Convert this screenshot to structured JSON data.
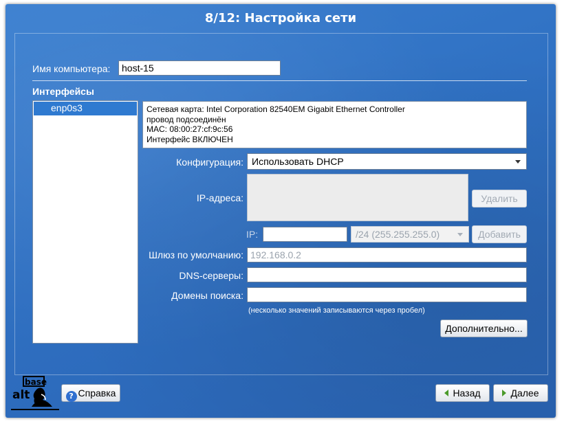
{
  "window": {
    "title": "8/12: Настройка сети"
  },
  "hostname": {
    "label": "Имя компьютера:",
    "value": "host-15"
  },
  "interfaces": {
    "heading": "Интерфейсы",
    "items": [
      "enp0s3"
    ]
  },
  "info": {
    "line1": "Сетевая карта: Intel Corporation 82540EM Gigabit Ethernet Controller",
    "line2": "провод подсоединён",
    "line3": "MAC: 08:00:27:cf:9c:56",
    "line4": "Интерфейс ВКЛЮЧЕН"
  },
  "config": {
    "label": "Конфигурация:",
    "value": "Использовать DHCP"
  },
  "ip_addresses": {
    "label": "IP-адреса:",
    "delete_label": "Удалить"
  },
  "ip": {
    "label": "IP:",
    "value": "",
    "mask": "/24 (255.255.255.0)",
    "add_label": "Добавить"
  },
  "gateway": {
    "label": "Шлюз по умолчанию:",
    "placeholder": "192.168.0.2"
  },
  "dns": {
    "label": "DNS-серверы:",
    "value": ""
  },
  "search_domains": {
    "label": "Домены поиска:",
    "value": "",
    "hint": "(несколько значений записываются через пробел)"
  },
  "advanced": {
    "label": "Дополнительно..."
  },
  "footer": {
    "logo_text_top": "base",
    "logo_text_bottom": "alt",
    "help_label": "Справка",
    "back_label": "Назад",
    "next_label": "Далее"
  },
  "colors": {
    "background": "#2f70c2",
    "selection": "#2f7ad0",
    "nav_arrow": "#4a9a2a"
  },
  "icons": {
    "help": "help-icon",
    "back": "arrow-left-icon",
    "next": "arrow-right-icon"
  }
}
